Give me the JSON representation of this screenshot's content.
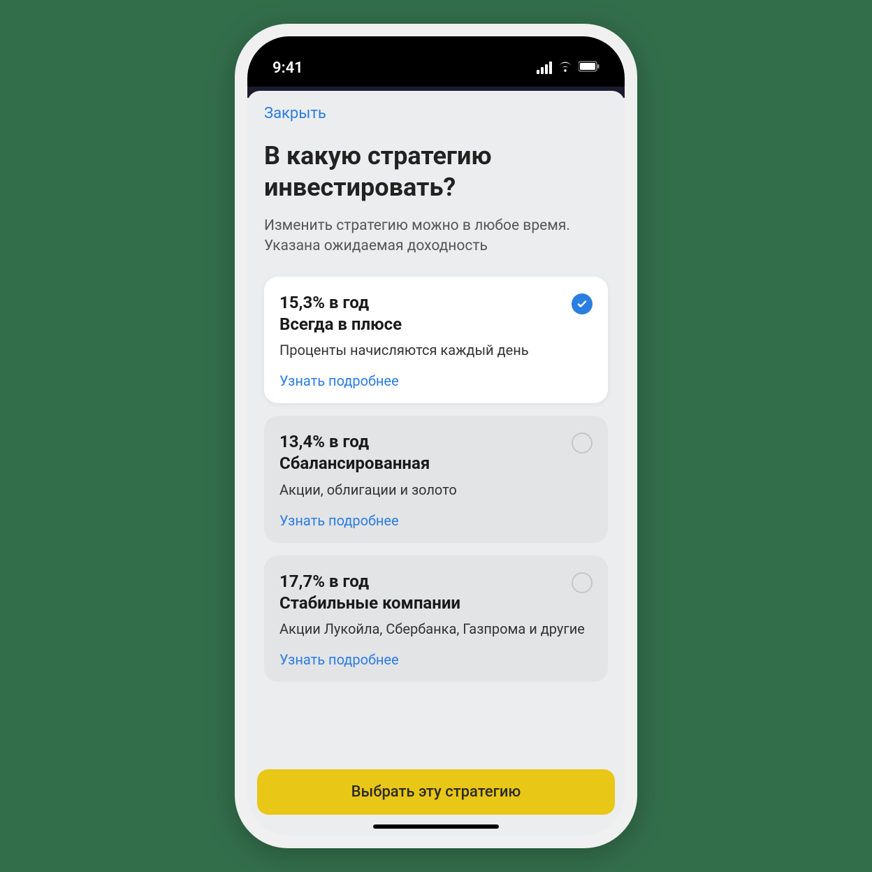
{
  "status": {
    "time": "9:41"
  },
  "header": {
    "close": "Закрыть",
    "title": "В какую стратегию инвестировать?",
    "subtitle": "Изменить стратегию можно в любое время. Указана ожидаемая доходность"
  },
  "strategies": [
    {
      "rate": "15,3% в год",
      "name": "Всегда в плюсе",
      "desc": "Проценты начисляются каждый день",
      "link": "Узнать подробнее",
      "selected": true
    },
    {
      "rate": "13,4% в год",
      "name": "Сбалансированная",
      "desc": "Акции, облигации и золото",
      "link": "Узнать подробнее",
      "selected": false
    },
    {
      "rate": "17,7% в год",
      "name": "Стабильные компании",
      "desc": "Акции Лукойла, Сбербанка, Газпрома и другие",
      "link": "Узнать подробнее",
      "selected": false
    }
  ],
  "cta": "Выбрать эту стратегию"
}
